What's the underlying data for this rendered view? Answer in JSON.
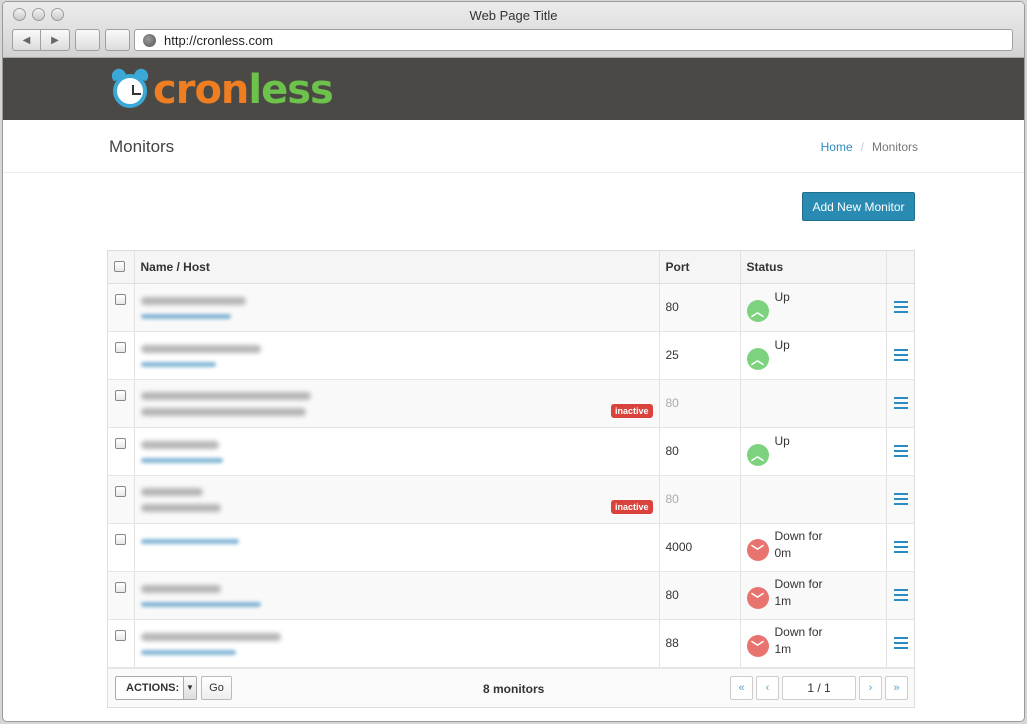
{
  "browser": {
    "window_title": "Web Page Title",
    "url": "http://cronless.com",
    "back_icon": "◀",
    "forward_icon": "▶"
  },
  "brand": {
    "logo_text_part1": "cron",
    "logo_text_part2": "less",
    "color_orange": "#ef7d22",
    "color_green": "#6cc24a"
  },
  "page": {
    "title": "Monitors",
    "breadcrumb": {
      "home": "Home",
      "separator": "/",
      "current": "Monitors"
    }
  },
  "toolbar": {
    "add_monitor_label": "Add New Monitor"
  },
  "table": {
    "headers": {
      "name_host": "Name / Host",
      "port": "Port",
      "status": "Status"
    },
    "rows": [
      {
        "port": "80",
        "status": "Up",
        "status_line2": "",
        "state": "up",
        "inactive": false
      },
      {
        "port": "25",
        "status": "Up",
        "status_line2": "",
        "state": "up",
        "inactive": false
      },
      {
        "port": "80",
        "status": "",
        "status_line2": "",
        "state": "none",
        "inactive": true,
        "badge": "inactive"
      },
      {
        "port": "80",
        "status": "Up",
        "status_line2": "",
        "state": "up",
        "inactive": false
      },
      {
        "port": "80",
        "status": "",
        "status_line2": "",
        "state": "none",
        "inactive": true,
        "badge": "inactive"
      },
      {
        "port": "4000",
        "status": "Down for",
        "status_line2": "0m",
        "state": "down",
        "inactive": false
      },
      {
        "port": "80",
        "status": "Down for",
        "status_line2": "1m",
        "state": "down",
        "inactive": false
      },
      {
        "port": "88",
        "status": "Down for",
        "status_line2": "1m",
        "state": "down",
        "inactive": false
      }
    ]
  },
  "footer": {
    "actions_label": "ACTIONS:",
    "go_label": "Go",
    "count": "8 monitors",
    "pager": {
      "first": "«",
      "prev": "‹",
      "current": "1 / 1",
      "next": "›",
      "last": "»"
    }
  }
}
